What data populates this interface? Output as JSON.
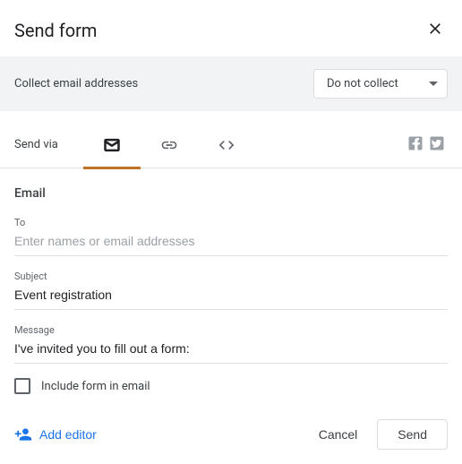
{
  "header": {
    "title": "Send form"
  },
  "collect": {
    "label": "Collect email addresses",
    "selected": "Do not collect"
  },
  "sendvia": {
    "label": "Send via"
  },
  "email": {
    "section_title": "Email",
    "to_label": "To",
    "to_placeholder": "Enter names or email addresses",
    "to_value": "",
    "subject_label": "Subject",
    "subject_value": "Event registration",
    "message_label": "Message",
    "message_value": "I've invited you to fill out a form:",
    "include_label": "Include form in email",
    "include_checked": false
  },
  "footer": {
    "add_editor": "Add editor",
    "cancel": "Cancel",
    "send": "Send"
  }
}
